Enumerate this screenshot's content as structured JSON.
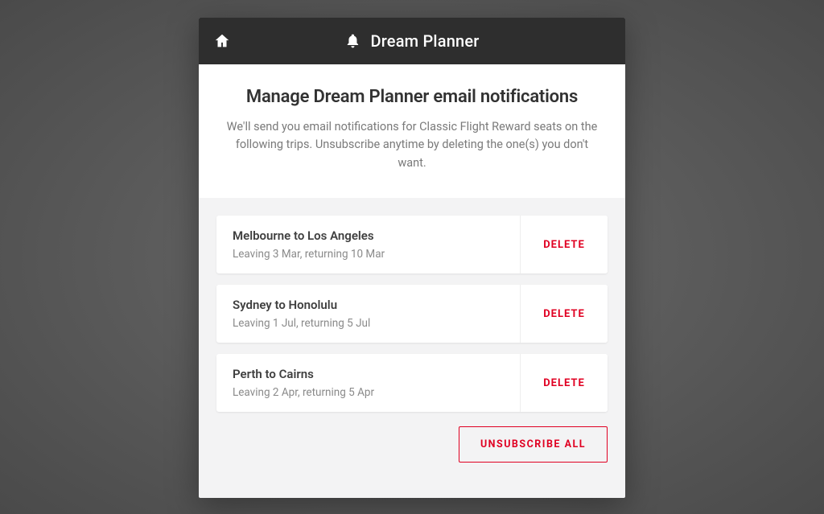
{
  "header": {
    "title": "Dream Planner"
  },
  "intro": {
    "heading": "Manage Dream Planner email notifications",
    "body": "We'll send you email notifications for Classic Flight Reward seats on the following trips. Unsubscribe anytime by deleting the one(s) you don't want."
  },
  "trips": [
    {
      "route": "Melbourne to Los Angeles",
      "dates": "Leaving 3 Mar, returning 10 Mar",
      "delete_label": "DELETE"
    },
    {
      "route": "Sydney to Honolulu",
      "dates": "Leaving 1 Jul, returning 5 Jul",
      "delete_label": "DELETE"
    },
    {
      "route": "Perth to Cairns",
      "dates": "Leaving 2 Apr, returning 5 Apr",
      "delete_label": "DELETE"
    }
  ],
  "actions": {
    "unsubscribe_all": "UNSUBSCRIBE ALL"
  }
}
